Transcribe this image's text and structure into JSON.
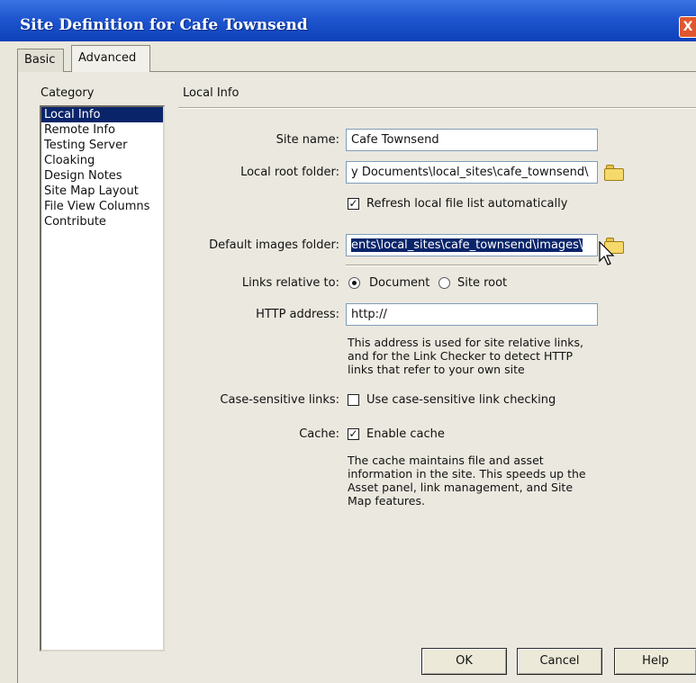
{
  "window": {
    "title": "Site Definition for Cafe Townsend",
    "close_glyph": "X"
  },
  "tabs": [
    {
      "label": "Basic"
    },
    {
      "label": "Advanced"
    }
  ],
  "category": {
    "label": "Category",
    "items": [
      {
        "label": "Local Info",
        "selected": true
      },
      {
        "label": "Remote Info"
      },
      {
        "label": "Testing Server"
      },
      {
        "label": "Cloaking"
      },
      {
        "label": "Design Notes"
      },
      {
        "label": "Site Map Layout"
      },
      {
        "label": "File View Columns"
      },
      {
        "label": "Contribute"
      }
    ]
  },
  "local_info": {
    "title": "Local Info",
    "site_name": {
      "label": "Site name:",
      "value": "Cafe Townsend"
    },
    "local_root": {
      "label": "Local root folder:",
      "value": "y Documents\\local_sites\\cafe_townsend\\",
      "icon": "folder-icon"
    },
    "refresh": {
      "label": "Refresh local file list automatically",
      "checked": true
    },
    "images_folder": {
      "label": "Default images folder:",
      "value": "ents\\local_sites\\cafe_townsend\\images\\",
      "icon": "folder-icon"
    },
    "links_relative": {
      "label": "Links relative to:",
      "option_document": "Document",
      "option_site_root": "Site root",
      "selected": "Document"
    },
    "http": {
      "label": "HTTP address:",
      "value": "http://",
      "help_lines": [
        "This address is used for site relative links,",
        "and for the Link Checker to detect HTTP",
        "links that refer to your own site"
      ]
    },
    "case_sensitive": {
      "label": "Case-sensitive links:",
      "option": "Use case-sensitive link checking",
      "checked": false
    },
    "cache": {
      "label": "Cache:",
      "option": "Enable cache",
      "checked": true,
      "help_lines": [
        "The cache maintains file and asset",
        "information in the site.  This speeds up the",
        "Asset panel, link management, and Site",
        "Map features."
      ]
    }
  },
  "buttons": {
    "ok": "OK",
    "cancel": "Cancel",
    "help": "Help"
  },
  "colors": {
    "titlebar": "#1f56cf",
    "selection": "#0a246a",
    "dialog": "#ebe8df"
  }
}
